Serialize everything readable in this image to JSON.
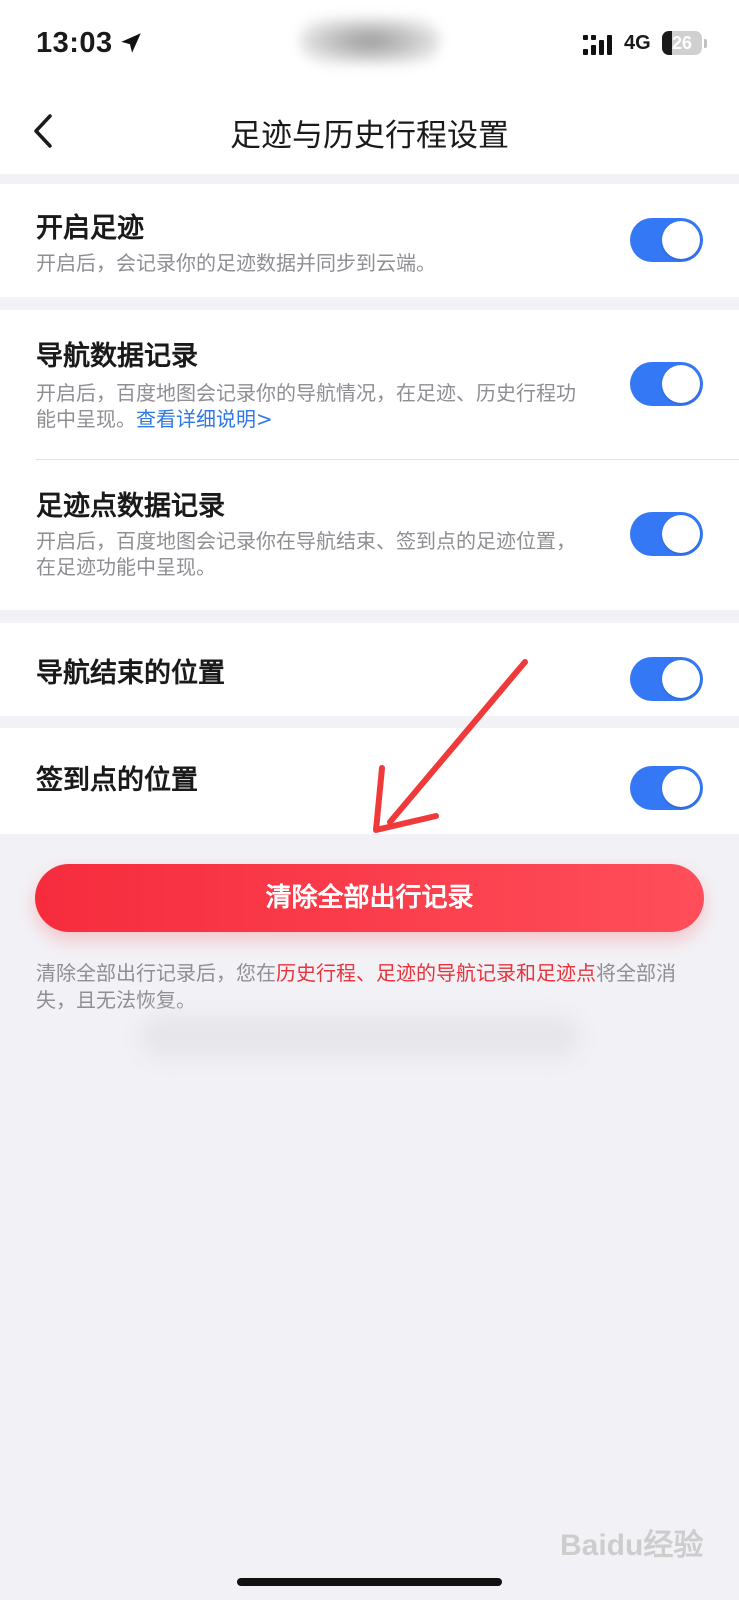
{
  "status_bar": {
    "time": "13:03",
    "network": "4G",
    "battery_level": "26"
  },
  "nav": {
    "title": "足迹与历史行程设置"
  },
  "settings": {
    "footprint": {
      "title": "开启足迹",
      "desc": "开启后，会记录你的足迹数据并同步到云端。",
      "enabled": true
    },
    "nav_record": {
      "title": "导航数据记录",
      "desc": "开启后，百度地图会记录你的导航情况，在足迹、历史行程功能中呈现。",
      "link": "查看详细说明>",
      "enabled": true
    },
    "footprint_point": {
      "title": "足迹点数据记录",
      "desc": "开启后，百度地图会记录你在导航结束、签到点的足迹位置，在足迹功能中呈现。",
      "enabled": true
    },
    "nav_end": {
      "title": "导航结束的位置",
      "enabled": true
    },
    "checkin": {
      "title": "签到点的位置",
      "enabled": true
    }
  },
  "clear_button": {
    "label": "清除全部出行记录"
  },
  "note": {
    "prefix": "清除全部出行记录后，您在",
    "highlight": "历史行程、足迹的导航记录和足迹点",
    "suffix": "将全部消失，且无法恢复。"
  },
  "watermark": "Baidu经验",
  "colors": {
    "toggle_on": "#3478f6",
    "danger": "#f62c3d",
    "link": "#2f78e8",
    "background": "#f2f2f6"
  }
}
